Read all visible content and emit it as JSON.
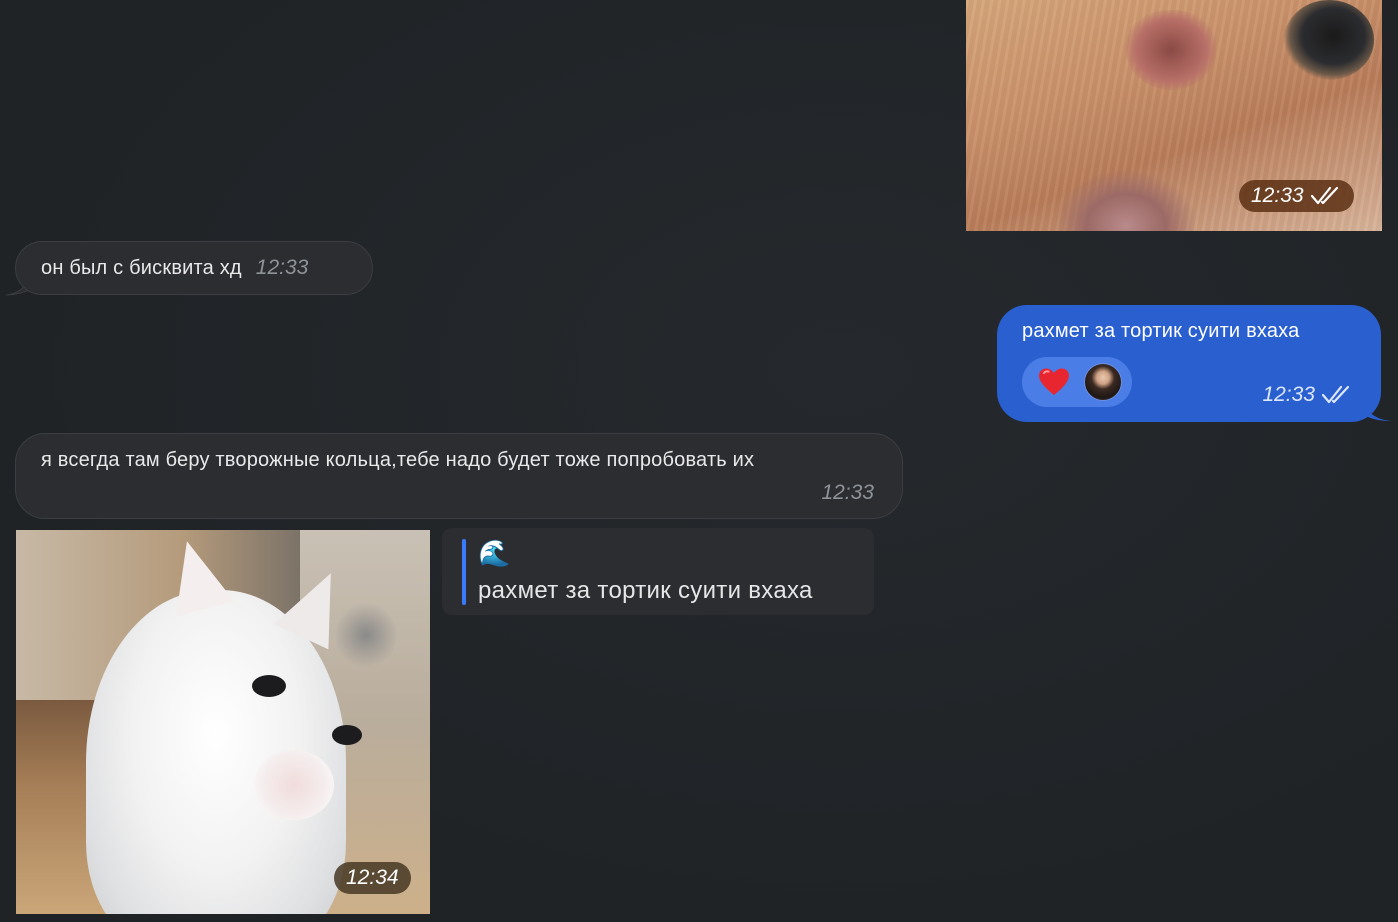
{
  "messages": {
    "photo_top": {
      "time": "12:33",
      "status_icon": "double-check-icon"
    },
    "incoming_1": {
      "text": "он был с бисквита хд",
      "time": "12:33"
    },
    "outgoing_1": {
      "text": "рахмет за тортик суити вхаха",
      "time": "12:33",
      "reaction": "❤️",
      "status_icon": "double-check-icon"
    },
    "incoming_2": {
      "text": "я всегда там беру творожные кольца,тебе надо будет тоже попробовать их",
      "time": "12:33"
    },
    "photo_kitten": {
      "time": "12:34"
    },
    "reply": {
      "author": "🌊",
      "quoted_text": "рахмет за тортик суити вхаха"
    }
  },
  "colors": {
    "background": "#212427",
    "incoming_bubble": "#2b2d30",
    "outgoing_bubble": "#2a5fcf",
    "reply_accent": "#3a7bff"
  }
}
